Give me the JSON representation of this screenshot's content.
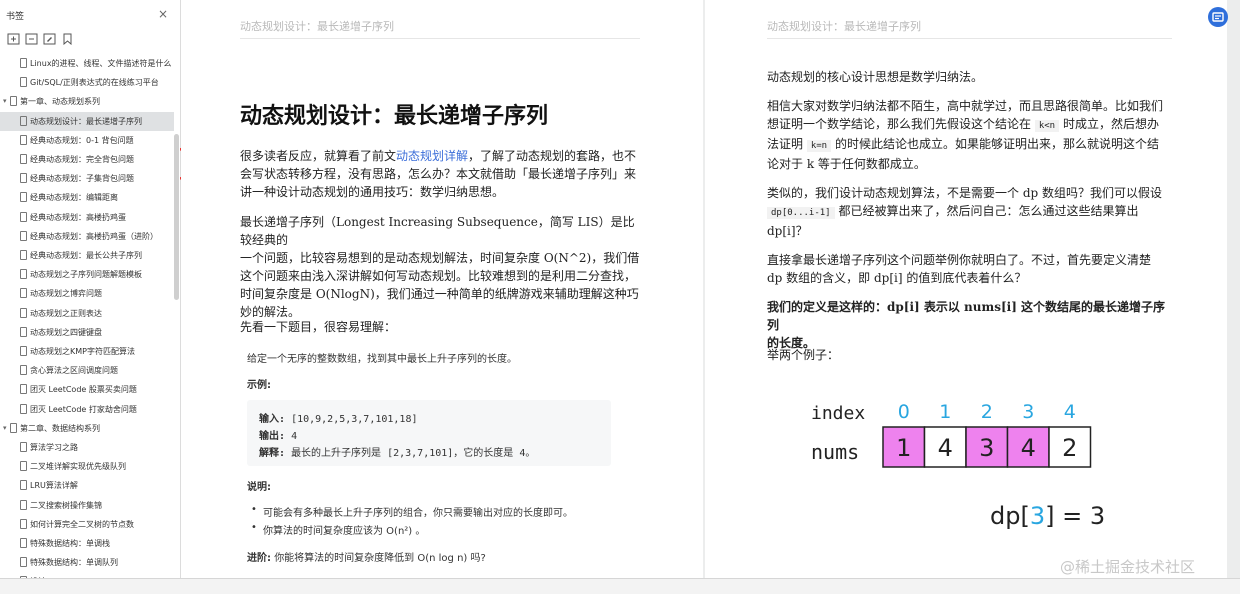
{
  "sidebar": {
    "title": "书签",
    "close": "×",
    "items": [
      {
        "label": "Linux的进程、线程、文件描述符是什么",
        "level": 1
      },
      {
        "label": "Git/SQL/正则表达式的在线练习平台",
        "level": 1
      },
      {
        "label": "第一章、动态规划系列",
        "level": 0,
        "caret": "▾"
      },
      {
        "label": "动态规划设计：最长递增子序列",
        "level": 1,
        "active": true
      },
      {
        "label": "经典动态规划：0-1 背包问题",
        "level": 1
      },
      {
        "label": "经典动态规划：完全背包问题",
        "level": 1
      },
      {
        "label": "经典动态规划：子集背包问题",
        "level": 1
      },
      {
        "label": "经典动态规划：编辑距离",
        "level": 1
      },
      {
        "label": "经典动态规划：高楼扔鸡蛋",
        "level": 1
      },
      {
        "label": "经典动态规划：高楼扔鸡蛋（进阶）",
        "level": 1
      },
      {
        "label": "经典动态规划：最长公共子序列",
        "level": 1
      },
      {
        "label": "动态规划之子序列问题解题模板",
        "level": 1
      },
      {
        "label": "动态规划之博弈问题",
        "level": 1
      },
      {
        "label": "动态规划之正则表达",
        "level": 1
      },
      {
        "label": "动态规划之四键键盘",
        "level": 1
      },
      {
        "label": "动态规划之KMP字符匹配算法",
        "level": 1
      },
      {
        "label": "贪心算法之区间调度问题",
        "level": 1
      },
      {
        "label": "团灭 LeetCode 股票买卖问题",
        "level": 1
      },
      {
        "label": "团灭 LeetCode 打家劫舍问题",
        "level": 1
      },
      {
        "label": "第二章、数据结构系列",
        "level": 0,
        "caret": "▾"
      },
      {
        "label": "算法学习之路",
        "level": 1
      },
      {
        "label": "二叉堆详解实现优先级队列",
        "level": 1
      },
      {
        "label": "LRU算法详解",
        "level": 1
      },
      {
        "label": "二叉搜索树操作集锦",
        "level": 1
      },
      {
        "label": "如何计算完全二叉树的节点数",
        "level": 1
      },
      {
        "label": "特殊数据结构：单调栈",
        "level": 1
      },
      {
        "label": "特殊数据结构：单调队列",
        "level": 1
      },
      {
        "label": "设计Twitter",
        "level": 1
      }
    ]
  },
  "left_page": {
    "running_head": "动态规划设计：最长递增子序列",
    "title": "动态规划设计：最长递增子序列",
    "p1_before_link": "很多读者反应，就算看了前文",
    "p1_link": "动态规划详解",
    "p1_after_link_l1": "，了解了动态规划的套路，也不",
    "p1_l2": "会写状态转移方程，没有思路，怎么办？本文就借助「最长递增子序列」来",
    "p1_l3": "讲一种设计动态规划的通用技巧：数学归纳思想。",
    "p2_l1": "最长递增子序列（Longest Increasing Subsequence，简写 LIS）是比较经典的",
    "p2_l2": "一个问题，比较容易想到的是动态规划解法，时间复杂度 O(N^2)，我们借",
    "p2_l3": "这个问题来由浅入深讲解如何写动态规划。比较难想到的是利用二分查找，",
    "p2_l4": "时间复杂度是 O(NlogN)，我们通过一种简单的纸牌游戏来辅助理解这种巧",
    "p2_l5": "妙的解法。",
    "p3": "先看一下题目，很容易理解：",
    "problem": {
      "statement": "给定一个无序的整数数组，找到其中最长上升子序列的长度。",
      "example_label": "示例:",
      "input_label": "输入:",
      "input_value": "[10,9,2,5,3,7,101,18]",
      "output_label": "输出:",
      "output_value": "4",
      "explain_label": "解释:",
      "explain_value": "最长的上升子序列是 [2,3,7,101]，它的长度是 4。",
      "note_label": "说明:",
      "note_1": "可能会有多种最长上升子序列的组合，你只需要输出对应的长度即可。",
      "note_2": "你算法的时间复杂度应该为 O(n²) 。",
      "advanced_label": "进阶:",
      "advanced_text": "你能将算法的时间复杂度降低到 O(n log n) 吗?"
    }
  },
  "right_page": {
    "running_head": "动态规划设计：最长递增子序列",
    "p1": "动态规划的核心设计思想是数学归纳法。",
    "p2_l1": "相信大家对数学归纳法都不陌生，高中就学过，而且思路很简单。比如我们",
    "p2_l2_a": "想证明一个数学结论，那么我们先假设这个结论在",
    "p2_l2_code": "k<n",
    "p2_l2_b": "时成立，然后想办",
    "p2_l3_a": "法证明",
    "p2_l3_code": "k=n",
    "p2_l3_b": "的时候此结论也成立。如果能够证明出来，那么就说明这个结",
    "p2_l4": "论对于 k 等于任何数都成立。",
    "p3_l1": "类似的，我们设计动态规划算法，不是需要一个 dp 数组吗？我们可以假设",
    "p3_l2_code": "dp[0...i-1]",
    "p3_l2_b": "都已经被算出来了，然后问自己：怎么通过这些结果算出",
    "p3_l3": "dp[i]？",
    "p4_l1": "直接拿最长递增子序列这个问题举例你就明白了。不过，首先要定义清楚",
    "p4_l2": "dp 数组的含义，即 dp[i] 的值到底代表着什么？",
    "p5_l1": "我们的定义是这样的：dp[i] 表示以 nums[i] 这个数结尾的最长递增子序列",
    "p5_l2": "的长度。",
    "p6": "举两个例子：",
    "figure": {
      "index_label": "index",
      "nums_label": "nums",
      "indices": [
        "0",
        "1",
        "2",
        "3",
        "4"
      ],
      "nums": [
        "1",
        "4",
        "3",
        "4",
        "2"
      ],
      "highlighted": [
        true,
        false,
        true,
        true,
        false
      ],
      "dp_text_prefix": "dp[",
      "dp_text_index": "3",
      "dp_text_suffix": "] = 3",
      "highlight_color": "#ee82ee",
      "index_color": "#29a6e0"
    }
  },
  "watermark": "@稀土掘金技术社区",
  "colors": {
    "arrow": "#e8322f",
    "accent": "#2f6fdb"
  }
}
